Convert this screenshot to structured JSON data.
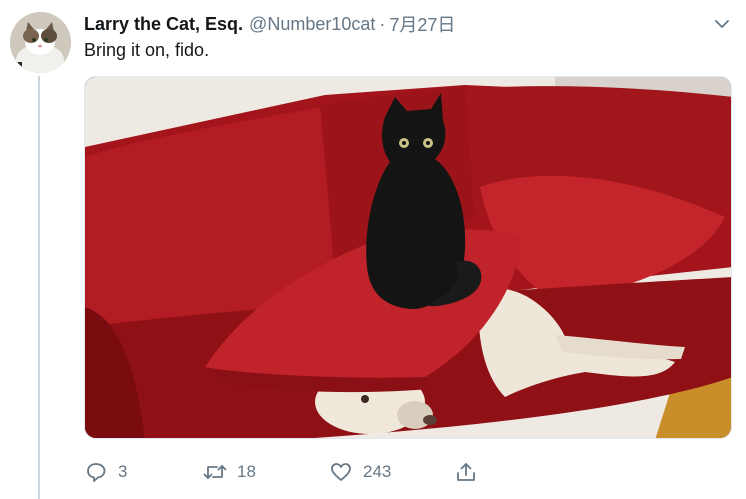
{
  "tweet": {
    "display_name": "Larry the Cat, Esq.",
    "handle": "@Number10cat",
    "separator": "·",
    "date": "7月27日",
    "text": "Bring it on, fido."
  },
  "actions": {
    "reply_icon": "reply-icon",
    "reply_count": "3",
    "retweet_icon": "retweet-icon",
    "retweet_count": "18",
    "like_icon": "heart-icon",
    "like_count": "243",
    "share_icon": "share-icon"
  },
  "colors": {
    "text_primary": "#14171a",
    "text_secondary": "#657786",
    "thread_line": "#ccd6dd"
  }
}
